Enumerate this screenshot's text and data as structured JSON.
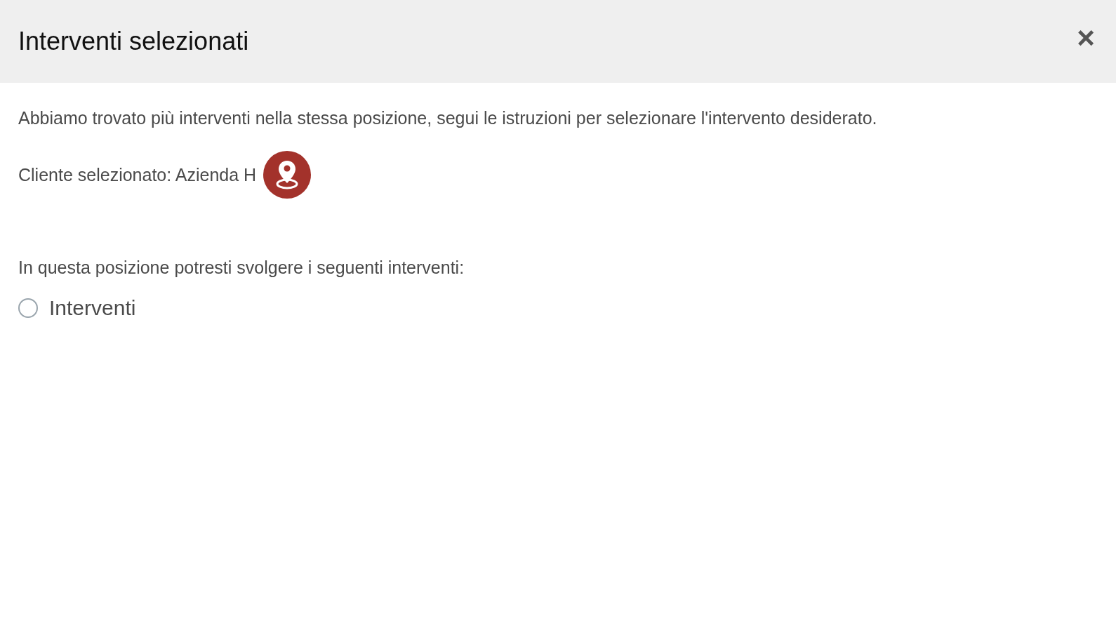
{
  "dialog": {
    "title": "Interventi selezionati",
    "close": "×"
  },
  "message": "Abbiamo trovato più interventi nella stessa posizione, segui le istruzioni per selezionare l'intervento desiderato.",
  "client": {
    "label": "Cliente selezionato: Azienda H"
  },
  "question": "In questa posizione potresti svolgere i seguenti interventi:",
  "options": [
    {
      "label": "Interventi",
      "selected": false
    }
  ]
}
